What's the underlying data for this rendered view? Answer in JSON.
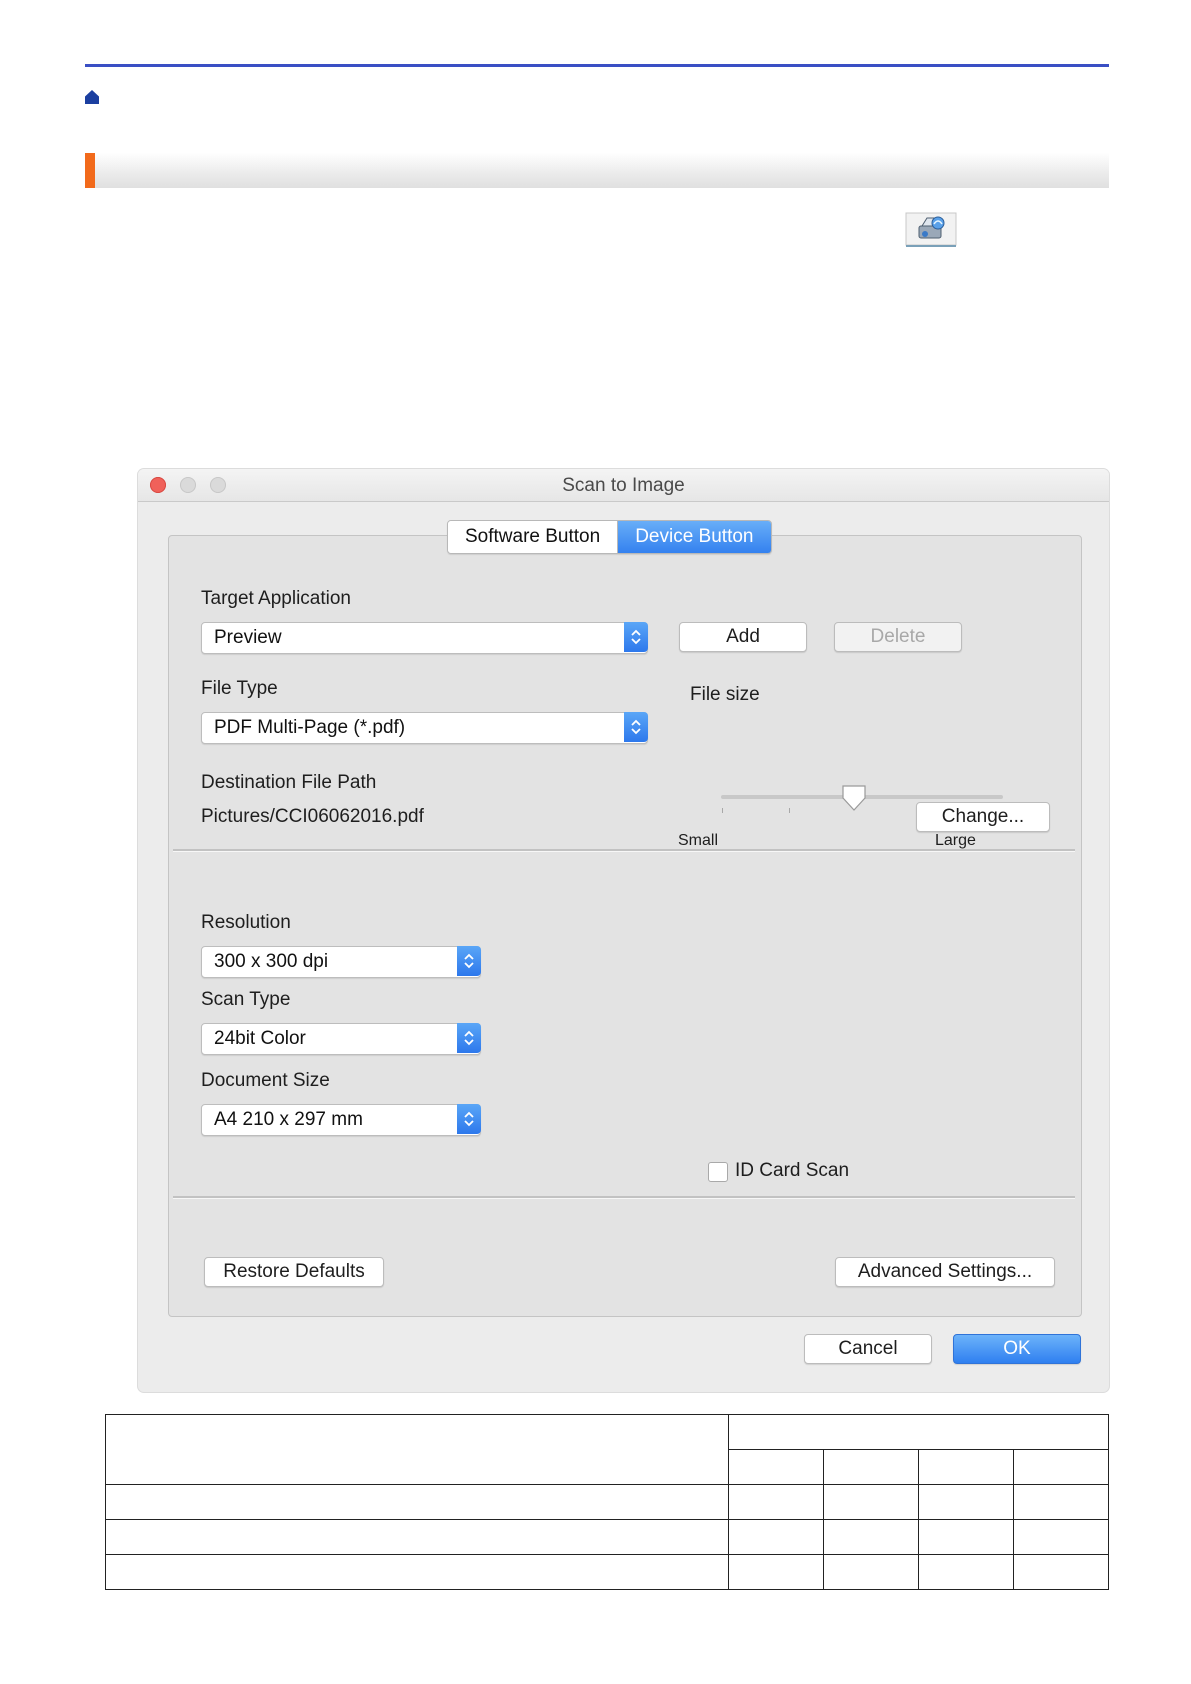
{
  "dialog": {
    "title": "Scan to Image",
    "tabs": [
      {
        "label": "Software Button",
        "active": false
      },
      {
        "label": "Device Button",
        "active": true
      }
    ],
    "target_application": {
      "label": "Target Application",
      "value": "Preview",
      "add_label": "Add",
      "delete_label": "Delete"
    },
    "file_type": {
      "label": "File Type",
      "value": "PDF Multi-Page (*.pdf)"
    },
    "file_size": {
      "label": "File size",
      "min_label": "Small",
      "max_label": "Large",
      "level": 0.5
    },
    "destination": {
      "label": "Destination File Path",
      "value": "Pictures/CCI06062016.pdf",
      "change_label": "Change..."
    },
    "resolution": {
      "label": "Resolution",
      "value": "300 x 300 dpi"
    },
    "scan_type": {
      "label": "Scan Type",
      "value": "24bit Color"
    },
    "document_size": {
      "label": "Document Size",
      "value": "A4 210 x 297 mm"
    },
    "id_card_scan": {
      "label": "ID Card Scan",
      "checked": false
    },
    "restore_defaults_label": "Restore Defaults",
    "advanced_settings_label": "Advanced Settings...",
    "cancel_label": "Cancel",
    "ok_label": "OK"
  },
  "colors": {
    "top_rule": "#3a4fc4",
    "section_accent": "#f26a1b",
    "accent_blue": "#3481ef",
    "close_light": "#f0615a"
  },
  "icons": [
    "home-icon",
    "scan-to-image-icon",
    "chevron-updown-icon"
  ]
}
